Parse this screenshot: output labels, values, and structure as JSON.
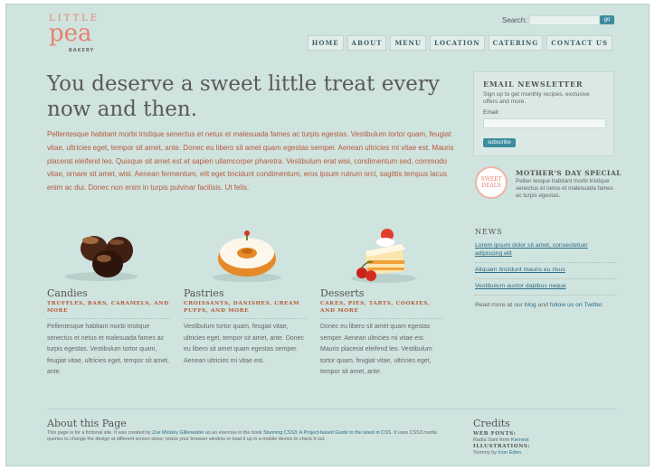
{
  "logo": {
    "line1": "LITTLE",
    "line2": "pea",
    "line3": "BAKERY"
  },
  "search": {
    "label": "Search:",
    "button": "go"
  },
  "nav": [
    "HOME",
    "ABOUT",
    "MENU",
    "LOCATION",
    "CATERING",
    "CONTACT US"
  ],
  "main": {
    "headline": "You deserve a sweet little treat every now and then.",
    "intro": "Pellentesque habitant morbi tristique senectus et netus et malesuada fames ac turpis egestas. Vestibulum tortor quam, feugiat vitae, ultricies eget, tempor sit amet, ante. Donec eu libero sit amet quam egestas semper. Aenean ultricies mi vitae est. Mauris placerat eleifend leo. Quisque sit amet est et sapien ullamcorper pharetra. Vestibulum erat wisi, condimentum sed, commodo vitae, ornare sit amet, wisi. Aenean fermentum, elit eget tincidunt condimentum, eros ipsum rutrum orci, sagittis tempus lacus enim ac dui. Donec non enim in turpis pulvinar facilisis. Ut felis."
  },
  "products": [
    {
      "title": "Candies",
      "subtitle": "Truffles, bars, caramels, and more",
      "desc": "Pellentesque habitant morbi tristique senectus et netus et malesuada fames ac turpis egestas. Vestibulum tortor quam, feugiat vitae, ultricies eget, tempor sit amet, ante."
    },
    {
      "title": "Pastries",
      "subtitle": "Croissants, danishes, cream puffs, and more",
      "desc": "Vestibulum tortor quam, feugiat vitae, ultricies eget, tempor sit amet, ante. Donec eu libero sit amet quam egestas semper. Aenean ultricies mi vitae est."
    },
    {
      "title": "Desserts",
      "subtitle": "Cakes, pies, tarts, cookies, and more",
      "desc": "Donec eu libero sit amet quam egestas semper. Aenean ultricies mi vitae est. Mauris placerat eleifend leo. Vestibulum tortor quam, feugiat vitae, ultricies eget, tempor sit amet, ante."
    }
  ],
  "newsletter": {
    "heading": "EMAIL NEWSLETTER",
    "desc": "Sign up to get monthly recipes, exclusive offers and more.",
    "email_label": "Email:",
    "button": "subscribe"
  },
  "special": {
    "badge_line1": "SWEET",
    "badge_line2": "DEALS",
    "heading": "MOTHER'S DAY SPECIAL",
    "desc": "Pellen tesque habitant morbi tristique senectus et netus et malesuada fames ac turpis egestas."
  },
  "news": {
    "heading": "NEWS",
    "items": [
      "Lorem ipsum dolor sit amet, consectetuer adipiscing elit",
      "Aliquam tincidunt mauris eu risus",
      "Vestibulum auctor dapibus neque"
    ],
    "more_prefix": "Read more at our",
    "more_blog": "blog",
    "more_mid": "and",
    "more_twitter": "follow us on Twitter",
    "more_suffix": "."
  },
  "about": {
    "heading": "About this Page",
    "t1": "This page is for a fictional site. It was created by",
    "author": "Zoe Mickley Gillenwater",
    "t2": "as an exercise in the book",
    "book": "Stunning CSS3: A Project-based Guide to the latest in CSS",
    "t3": ". It uses CSS3 media queries to change the design at different screen sizes; resize your browser window or load it up in a mobile device to check it out."
  },
  "credits": {
    "heading": "Credits",
    "fonts_label": "WEB FONTS:",
    "fonts_text": "Radla Sant from",
    "fonts_link": "Kernest",
    "illus_label": "ILLUSTRATIONS:",
    "illus_text": "Yummy by",
    "illus_link": "Icon Eden"
  }
}
